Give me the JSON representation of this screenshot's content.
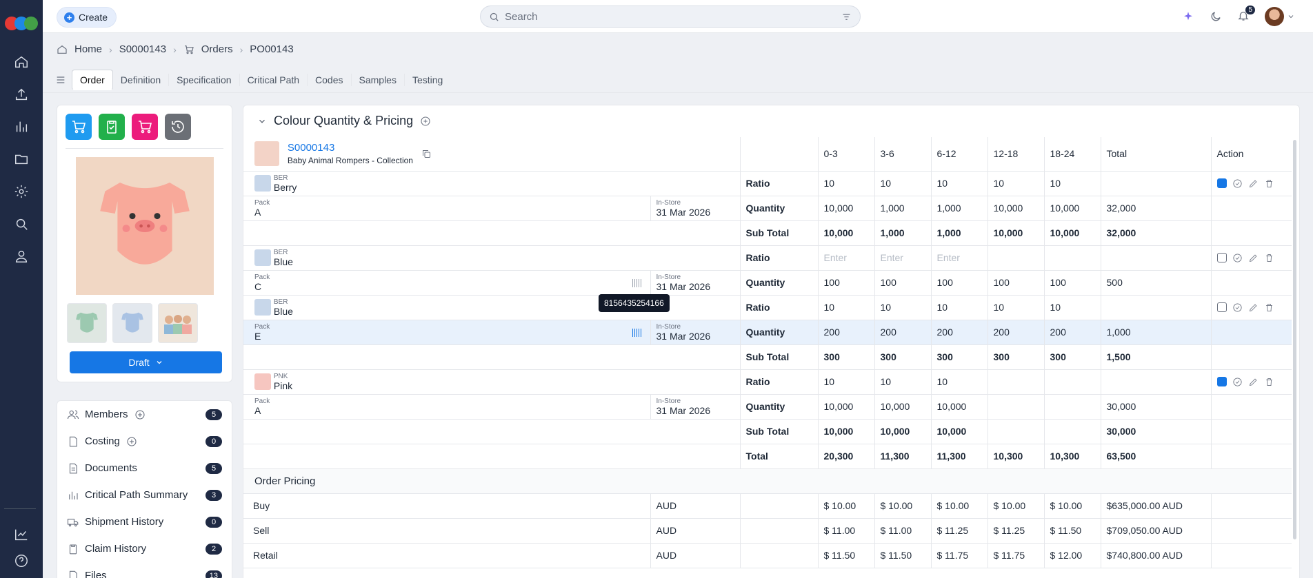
{
  "topbar": {
    "create_label": "Create",
    "search_placeholder": "Search",
    "notif_count": "5"
  },
  "breadcrumb": {
    "home": "Home",
    "style": "S0000143",
    "orders": "Orders",
    "po": "PO00143"
  },
  "tabs": [
    "Order",
    "Definition",
    "Specification",
    "Critical Path",
    "Codes",
    "Samples",
    "Testing"
  ],
  "left": {
    "draft_label": "Draft",
    "list": [
      {
        "label": "Members",
        "count": "5",
        "add": true
      },
      {
        "label": "Costing",
        "count": "0",
        "add": true
      },
      {
        "label": "Documents",
        "count": "5"
      },
      {
        "label": "Critical Path Summary",
        "count": "3"
      },
      {
        "label": "Shipment History",
        "count": "0"
      },
      {
        "label": "Claim History",
        "count": "2"
      },
      {
        "label": "Files",
        "count": "13"
      }
    ]
  },
  "section": {
    "title": "Colour Quantity & Pricing"
  },
  "header": {
    "style_code": "S0000143",
    "style_name": "Baby Animal Rompers - Collection",
    "sizes": [
      "0-3",
      "3-6",
      "6-12",
      "12-18",
      "18-24"
    ],
    "total": "Total",
    "action": "Action"
  },
  "colors": {
    "accent": "#1677e5",
    "nav": "#1f2a44",
    "highlight": "#e8f1fc"
  },
  "rows": [
    {
      "code": "BER",
      "name": "Berry",
      "pack": "A",
      "store": "In-Store",
      "date": "31 Mar 2026",
      "ratio": [
        "10",
        "10",
        "10",
        "10",
        "10"
      ],
      "qty": [
        "10,000",
        "1,000",
        "1,000",
        "10,000",
        "10,000"
      ],
      "qty_total": "32,000"
    },
    {
      "sub_label": "Sub Total",
      "vals": [
        "10,000",
        "1,000",
        "1,000",
        "10,000",
        "10,000"
      ],
      "total": "32,000"
    },
    {
      "code": "BER",
      "name": "Blue",
      "pack": "C",
      "store": "In-Store",
      "date": "31 Mar 2026",
      "ratio": [
        "Enter",
        "Enter",
        "Enter",
        "",
        ""
      ],
      "qty": [
        "100",
        "100",
        "100",
        "100",
        "100"
      ],
      "qty_total": "500"
    },
    {
      "code": "BER",
      "name": "Blue",
      "pack": "E",
      "store": "In-Store",
      "date": "31 Mar 2026",
      "ratio": [
        "10",
        "10",
        "10",
        "10",
        "10"
      ],
      "qty": [
        "200",
        "200",
        "200",
        "200",
        "200"
      ],
      "qty_total": "1,000"
    },
    {
      "sub_label": "Sub Total",
      "vals": [
        "300",
        "300",
        "300",
        "300",
        "300"
      ],
      "total": "1,500"
    },
    {
      "code": "PNK",
      "name": "Pink",
      "pack": "A",
      "store": "In-Store",
      "date": "31 Mar 2026",
      "ratio": [
        "10",
        "10",
        "10",
        "",
        ""
      ],
      "qty": [
        "10,000",
        "10,000",
        "10,000",
        "",
        ""
      ],
      "qty_total": "30,000"
    },
    {
      "sub_label": "Sub Total",
      "vals": [
        "10,000",
        "10,000",
        "10,000",
        "",
        ""
      ],
      "total": "30,000"
    },
    {
      "sub_label": "Total",
      "vals": [
        "20,300",
        "11,300",
        "11,300",
        "10,300",
        "10,300"
      ],
      "total": "63,500"
    }
  ],
  "labels": {
    "pack": "Pack",
    "ratio": "Ratio",
    "quantity": "Quantity",
    "order_pricing": "Order Pricing"
  },
  "pricing": [
    {
      "label": "Buy",
      "currency": "AUD",
      "vals": [
        "$ 10.00",
        "$ 10.00",
        "$ 10.00",
        "$ 10.00",
        "$ 10.00"
      ],
      "total": "$635,000.00 AUD"
    },
    {
      "label": "Sell",
      "currency": "AUD",
      "vals": [
        "$ 11.00",
        "$ 11.00",
        "$ 11.25",
        "$ 11.25",
        "$ 11.50"
      ],
      "total": "$709,050.00 AUD"
    },
    {
      "label": "Retail",
      "currency": "AUD",
      "vals": [
        "$ 11.50",
        "$ 11.50",
        "$ 11.75",
        "$ 11.75",
        "$ 12.00"
      ],
      "total": "$740,800.00 AUD"
    }
  ],
  "tooltip": "8156435254166"
}
